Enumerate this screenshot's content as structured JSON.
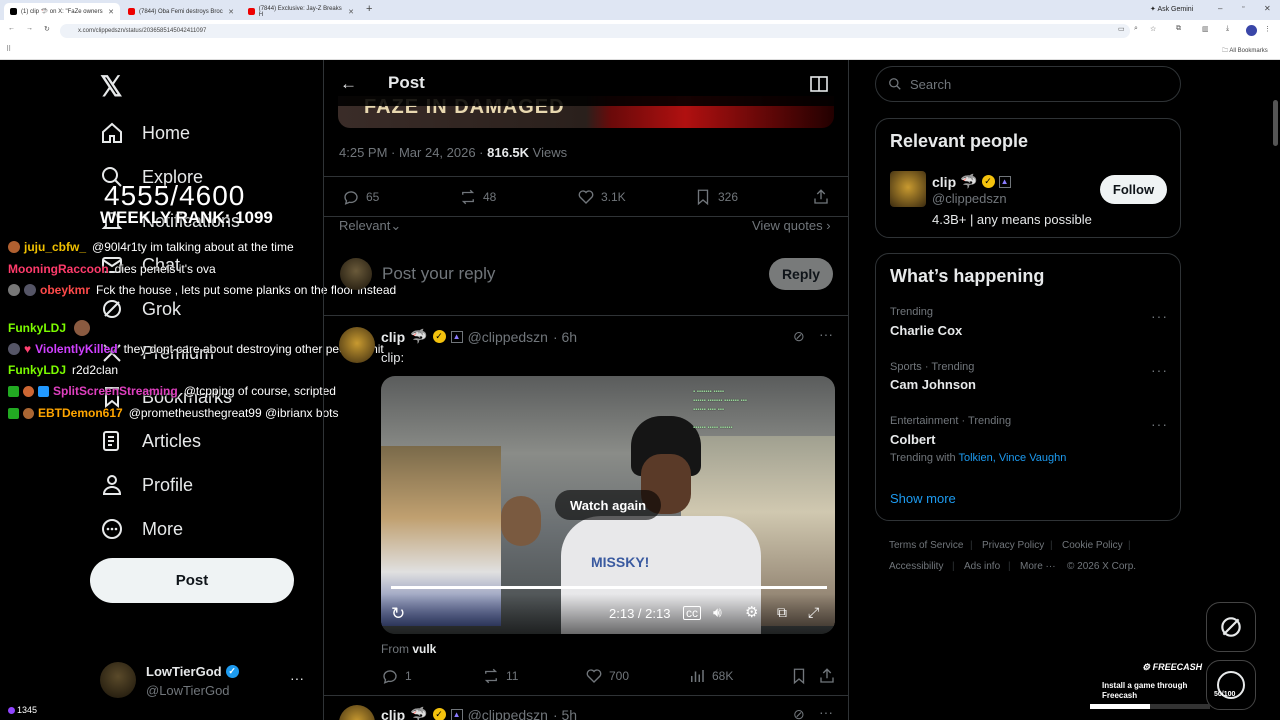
{
  "browser": {
    "tabs": [
      {
        "title": "(1) clip 🦈 on X: \"FaZe owners",
        "color": "#000"
      },
      {
        "title": "(7844) Oba Femi destroys Broc",
        "color": "#e00"
      },
      {
        "title": "(7844) Exclusive: Jay-Z Breaks H",
        "color": "#e00"
      }
    ],
    "new_tab": "+",
    "ask_gemini": "Ask Gemini",
    "url": "x.com/clippedszn/status/2036585145042411097",
    "all_bookmarks": "All Bookmarks"
  },
  "nav": {
    "logo": "𝕏",
    "items": [
      {
        "label": "Home",
        "icon": "home-icon"
      },
      {
        "label": "Explore",
        "icon": "search-icon"
      },
      {
        "label": "Notifications",
        "icon": "bell-icon"
      },
      {
        "label": "Chat",
        "icon": "mail-icon"
      },
      {
        "label": "Grok",
        "icon": "grok-icon"
      },
      {
        "label": "Premium",
        "icon": "x-premium-icon"
      },
      {
        "label": "Bookmarks",
        "icon": "bookmark-icon"
      },
      {
        "label": "Articles",
        "icon": "article-icon"
      },
      {
        "label": "Profile",
        "icon": "profile-icon"
      },
      {
        "label": "More",
        "icon": "more-circle-icon"
      }
    ],
    "post_button": "Post",
    "account": {
      "name": "LowTierGod",
      "handle": "@LowTierGod",
      "more": "···"
    }
  },
  "stream_overlay": {
    "score": "4555/4600",
    "subtitle": "WEEKLY RANK: 1099",
    "viewer_count": "1345",
    "chat": [
      {
        "user": "juju_cbfw_",
        "color": "#f0c000",
        "msg": "@90l4r1ty im talking about at the time"
      },
      {
        "user": "MooningRaccoon",
        "color": "#ff3b6b",
        "msg": "dies penels it's ova"
      },
      {
        "user": "obeykmr",
        "color": "#ff4a4a",
        "msg": "Fck the house , lets put some planks on the floor instead"
      },
      {
        "user": "FunkyLDJ",
        "color": "#7cfc00",
        "msg": ""
      },
      {
        "user": "ViolentlyKilled",
        "color": "#d040ff",
        "msg": "they dont care about destroying other people shit"
      },
      {
        "user": "FunkyLDJ",
        "color": "#7cfc00",
        "msg": "r2d2clan"
      },
      {
        "user": "SplitScreenStreaming",
        "color": "#e040c0",
        "msg": "@tcpping of course, scripted"
      },
      {
        "user": "EBTDemon617",
        "color": "#ffa500",
        "msg": "@prometheusthegreat99 @ibrianx bots"
      }
    ]
  },
  "main": {
    "header_title": "Post",
    "banner_text": "FAZE IN DAMAGED",
    "post_time": "4:25 PM · Mar 24, 2026 · ",
    "views_count": "816.5K",
    "views_label": " Views",
    "stats": {
      "replies": "65",
      "reposts": "48",
      "likes": "3.1K",
      "bookmarks": "326"
    },
    "relevant": "Relevant",
    "view_quotes": "View quotes",
    "reply_placeholder": "Post your reply",
    "reply_button": "Reply",
    "reply_post": {
      "name": "clip",
      "emoji": "🦈",
      "handle": "@clippedszn",
      "time": "· 6h",
      "text": "clip:",
      "watch_again": "Watch again",
      "video_time": "2:13 / 2:13",
      "progress": 1.0,
      "from_label": "From ",
      "from_user": "vulk",
      "stats": {
        "replies": "1",
        "reposts": "11",
        "likes": "700",
        "views": "68K"
      },
      "video_shirt_text": "MISSKY!"
    },
    "next_post": {
      "name": "clip",
      "emoji": "🦈",
      "handle": "@clippedszn",
      "time": "· 5h"
    }
  },
  "right": {
    "search_placeholder": "Search",
    "relevant_people_title": "Relevant people",
    "person": {
      "name": "clip",
      "emoji": "🦈",
      "handle": "@clippedszn",
      "bio": "4.3B+ | any means possible",
      "follow": "Follow"
    },
    "whats_happening_title": "What’s happening",
    "trends": [
      {
        "category": "Trending",
        "name": "Charlie Cox"
      },
      {
        "category": "Sports · Trending",
        "name": "Cam Johnson"
      },
      {
        "category": "Entertainment · Trending",
        "name": "Colbert",
        "with_label": "Trending with ",
        "with_links": "Tolkien, Vince Vaughn"
      }
    ],
    "show_more": "Show more",
    "footer": [
      "Terms of Service",
      "Privacy Policy",
      "Cookie Policy",
      "Accessibility",
      "Ads info",
      "More ···",
      "© 2026 X Corp."
    ],
    "ad": {
      "brand": "FREECASH",
      "text": "Install a game through Freecash",
      "count": "50/100"
    }
  },
  "colors": {
    "accent": "#1d9bf0",
    "verified": "#f4c20d",
    "background": "#000000",
    "border": "#2f3336"
  }
}
